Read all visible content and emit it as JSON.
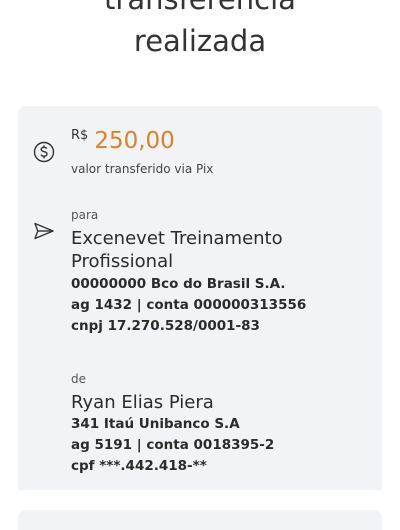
{
  "header": {
    "title_line1": "transferência",
    "title_line2": "realizada"
  },
  "amount": {
    "currency": "R$",
    "value": "250,00",
    "caption": "valor transferido via Pix",
    "icon": "dollar-circle-icon",
    "color": "#d9822b"
  },
  "recipient": {
    "label": "para",
    "icon": "send-icon",
    "name": "Excenevet Treinamento Profissional",
    "bank": "00000000 Bco do Brasil S.A.",
    "account": "ag 1432 | conta 000000313556",
    "document": "cnpj 17.270.528/0001-83"
  },
  "sender": {
    "label": "de",
    "name": "Ryan Elias Piera",
    "bank": "341 Itaú Unibanco S.A",
    "account": "ag 5191 | conta 0018395-2",
    "document": "cpf ***.442.418-**"
  }
}
